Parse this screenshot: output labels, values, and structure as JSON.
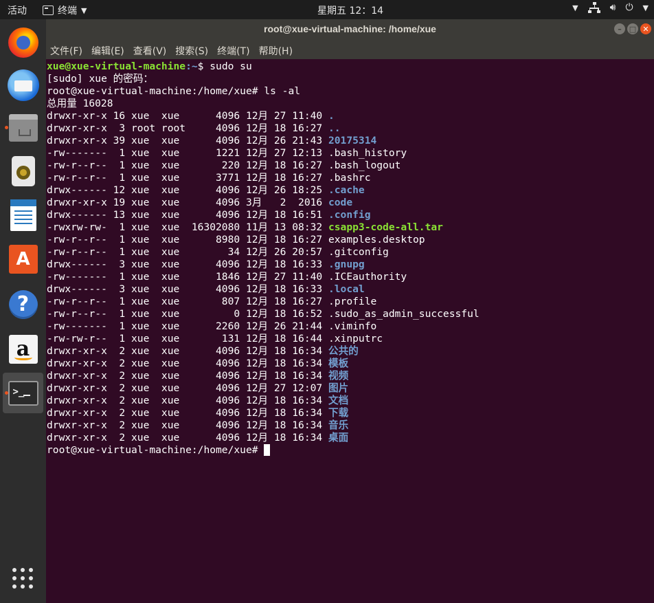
{
  "topbar": {
    "activities": "活动",
    "app_name": "终端",
    "clock": "星期五 12：14"
  },
  "window": {
    "title": "root@xue-virtual-machine: /home/xue"
  },
  "menu": [
    "文件(F)",
    "编辑(E)",
    "查看(V)",
    "搜索(S)",
    "终端(T)",
    "帮助(H)"
  ],
  "terminal": {
    "prompt1_user": "xue@xue-virtual-machine",
    "prompt1_path": ":~",
    "prompt1_cmd": "$ sudo su",
    "sudo_prompt": "[sudo] xue 的密码：",
    "root_cmd": "root@xue-virtual-machine:/home/xue# ls -al",
    "total": "总用量 16028",
    "entries": [
      {
        "meta": "drwxr-xr-x 16 xue  xue      4096 12月 27 11:40 ",
        "name": ".",
        "kind": "dir"
      },
      {
        "meta": "drwxr-xr-x  3 root root     4096 12月 18 16:27 ",
        "name": "..",
        "kind": "dir"
      },
      {
        "meta": "drwxr-xr-x 39 xue  xue      4096 12月 26 21:43 ",
        "name": "20175314",
        "kind": "dir"
      },
      {
        "meta": "-rw-------  1 xue  xue      1221 12月 27 12:13 ",
        "name": ".bash_history",
        "kind": "file"
      },
      {
        "meta": "-rw-r--r--  1 xue  xue       220 12月 18 16:27 ",
        "name": ".bash_logout",
        "kind": "file"
      },
      {
        "meta": "-rw-r--r--  1 xue  xue      3771 12月 18 16:27 ",
        "name": ".bashrc",
        "kind": "file"
      },
      {
        "meta": "drwx------ 12 xue  xue      4096 12月 26 18:25 ",
        "name": ".cache",
        "kind": "dir"
      },
      {
        "meta": "drwxr-xr-x 19 xue  xue      4096 3月   2  2016 ",
        "name": "code",
        "kind": "dir"
      },
      {
        "meta": "drwx------ 13 xue  xue      4096 12月 18 16:51 ",
        "name": ".config",
        "kind": "dir"
      },
      {
        "meta": "-rwxrw-rw-  1 xue  xue  16302080 11月 13 08:32 ",
        "name": "csapp3-code-all.tar",
        "kind": "exec"
      },
      {
        "meta": "-rw-r--r--  1 xue  xue      8980 12月 18 16:27 ",
        "name": "examples.desktop",
        "kind": "file"
      },
      {
        "meta": "-rw-r--r--  1 xue  xue        34 12月 26 20:57 ",
        "name": ".gitconfig",
        "kind": "file"
      },
      {
        "meta": "drwx------  3 xue  xue      4096 12月 18 16:33 ",
        "name": ".gnupg",
        "kind": "dir"
      },
      {
        "meta": "-rw-------  1 xue  xue      1846 12月 27 11:40 ",
        "name": ".ICEauthority",
        "kind": "file"
      },
      {
        "meta": "drwx------  3 xue  xue      4096 12月 18 16:33 ",
        "name": ".local",
        "kind": "dir"
      },
      {
        "meta": "-rw-r--r--  1 xue  xue       807 12月 18 16:27 ",
        "name": ".profile",
        "kind": "file"
      },
      {
        "meta": "-rw-r--r--  1 xue  xue         0 12月 18 16:52 ",
        "name": ".sudo_as_admin_successful",
        "kind": "file"
      },
      {
        "meta": "-rw-------  1 xue  xue      2260 12月 26 21:44 ",
        "name": ".viminfo",
        "kind": "file"
      },
      {
        "meta": "-rw-rw-r--  1 xue  xue       131 12月 18 16:44 ",
        "name": ".xinputrc",
        "kind": "file"
      },
      {
        "meta": "drwxr-xr-x  2 xue  xue      4096 12月 18 16:34 ",
        "name": "公共的",
        "kind": "dir"
      },
      {
        "meta": "drwxr-xr-x  2 xue  xue      4096 12月 18 16:34 ",
        "name": "模板",
        "kind": "dir"
      },
      {
        "meta": "drwxr-xr-x  2 xue  xue      4096 12月 18 16:34 ",
        "name": "视频",
        "kind": "dir"
      },
      {
        "meta": "drwxr-xr-x  2 xue  xue      4096 12月 27 12:07 ",
        "name": "图片",
        "kind": "dir"
      },
      {
        "meta": "drwxr-xr-x  2 xue  xue      4096 12月 18 16:34 ",
        "name": "文档",
        "kind": "dir"
      },
      {
        "meta": "drwxr-xr-x  2 xue  xue      4096 12月 18 16:34 ",
        "name": "下载",
        "kind": "dir"
      },
      {
        "meta": "drwxr-xr-x  2 xue  xue      4096 12月 18 16:34 ",
        "name": "音乐",
        "kind": "dir"
      },
      {
        "meta": "drwxr-xr-x  2 xue  xue      4096 12月 18 16:34 ",
        "name": "桌面",
        "kind": "dir"
      }
    ],
    "final_prompt": "root@xue-virtual-machine:/home/xue# "
  },
  "dock": {
    "items": [
      "firefox-icon",
      "thunderbird-icon",
      "files-icon",
      "rhythmbox-icon",
      "writer-icon",
      "software-center-icon",
      "help-icon",
      "amazon-icon",
      "terminal-icon"
    ],
    "term_glyph": ">_",
    "store_glyph": "A",
    "help_glyph": "?",
    "amazon_glyph": "a"
  },
  "colors": {
    "terminal_bg": "#300a24",
    "dir": "#729fcf",
    "exec": "#8ae234",
    "accent": "#e95420"
  }
}
